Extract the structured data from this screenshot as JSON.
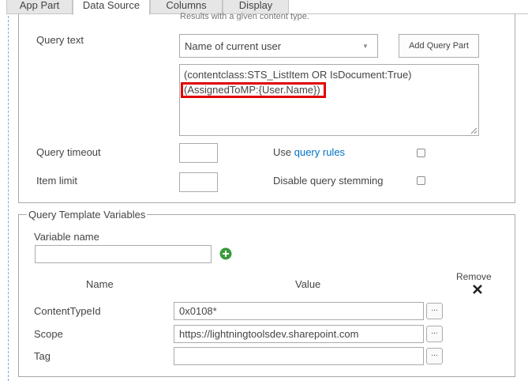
{
  "tabs": [
    {
      "label": "App Part",
      "active": false
    },
    {
      "label": "Data Source",
      "active": true
    },
    {
      "label": "Columns",
      "active": false
    },
    {
      "label": "Display",
      "active": false
    }
  ],
  "top_panel": {
    "cut_off_text": "Results with a given content type.",
    "query_text_label": "Query text",
    "query_part_select_value": "Name of current user",
    "add_query_part_label": "Add Query Part",
    "query_lines": [
      "(contentclass:STS_ListItem OR IsDocument:True)",
      "(AssignedToMP:{User.Name})"
    ],
    "highlight_color": "#e00000",
    "query_timeout_label": "Query timeout",
    "query_timeout_value": "",
    "use_prefix": "Use ",
    "query_rules_link": "query rules",
    "use_query_rules_checked": false,
    "item_limit_label": "Item limit",
    "item_limit_value": "",
    "disable_stemming_label": "Disable query stemming",
    "disable_stemming_checked": false
  },
  "variables_panel": {
    "legend": "Query Template Variables",
    "variable_name_label": "Variable name",
    "variable_name_value": "",
    "add_icon": "plus-circle-icon",
    "add_icon_color": "#3a9a3a",
    "col_name": "Name",
    "col_value": "Value",
    "col_remove": "Remove",
    "remove_icon": "x-icon",
    "rows": [
      {
        "name": "ContentTypeId",
        "value": "0x0108*"
      },
      {
        "name": "Scope",
        "value": "https://lightningtoolsdev.sharepoint.com"
      },
      {
        "name": "Tag",
        "value": ""
      }
    ],
    "ellipsis_label": "..."
  }
}
